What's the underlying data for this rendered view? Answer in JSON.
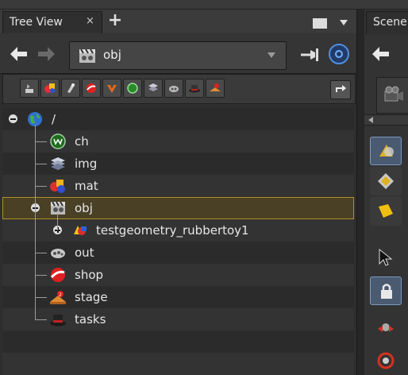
{
  "tree_view_tab": {
    "label": "Tree View",
    "close": "×",
    "add": "+"
  },
  "scene_tab": {
    "label": "Scene"
  },
  "path": {
    "value": "obj"
  },
  "filter_icons": [
    "sop-icon",
    "compositing-icon",
    "chop-icon",
    "shop-icon",
    "vop-icon",
    "channel-icon",
    "image-icon",
    "output-icon",
    "task-icon",
    "stage-icon"
  ],
  "tree": {
    "root": "/",
    "items": [
      {
        "label": "ch"
      },
      {
        "label": "img"
      },
      {
        "label": "mat"
      },
      {
        "label": "obj"
      },
      {
        "label": "testgeometry_rubbertoy1"
      },
      {
        "label": "out"
      },
      {
        "label": "shop"
      },
      {
        "label": "stage"
      },
      {
        "label": "tasks"
      }
    ]
  },
  "colors": {
    "selection_bg": "#4a4026",
    "selection_border": "#b09020",
    "accent_blue": "#4f8fe0"
  }
}
